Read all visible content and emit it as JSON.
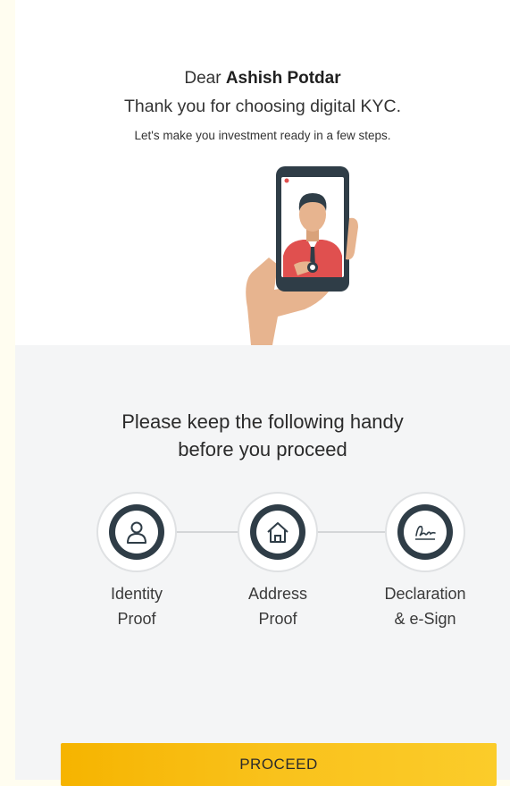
{
  "greeting": {
    "prefix": "Dear",
    "name": "Ashish Potdar"
  },
  "thanks": "Thank you for choosing digital KYC.",
  "subtext": "Let's make you investment ready in a few steps.",
  "illustration": {
    "icon": "hand-holding-phone-selfie-icon"
  },
  "handy": {
    "line1": "Please keep the following handy",
    "line2": "before you proceed"
  },
  "steps": [
    {
      "label_line1": "Identity",
      "label_line2": "Proof",
      "icon": "user-icon"
    },
    {
      "label_line1": "Address",
      "label_line2": "Proof",
      "icon": "home-icon"
    },
    {
      "label_line1": "Declaration",
      "label_line2": "& e-Sign",
      "icon": "signature-icon"
    }
  ],
  "proceed_button": {
    "label": "PROCEED"
  },
  "colors": {
    "accent": "#f9c21c",
    "icon_dark": "#2f3d47",
    "section_bg": "#f4f5f6",
    "phone_shirt": "#e0504f"
  }
}
